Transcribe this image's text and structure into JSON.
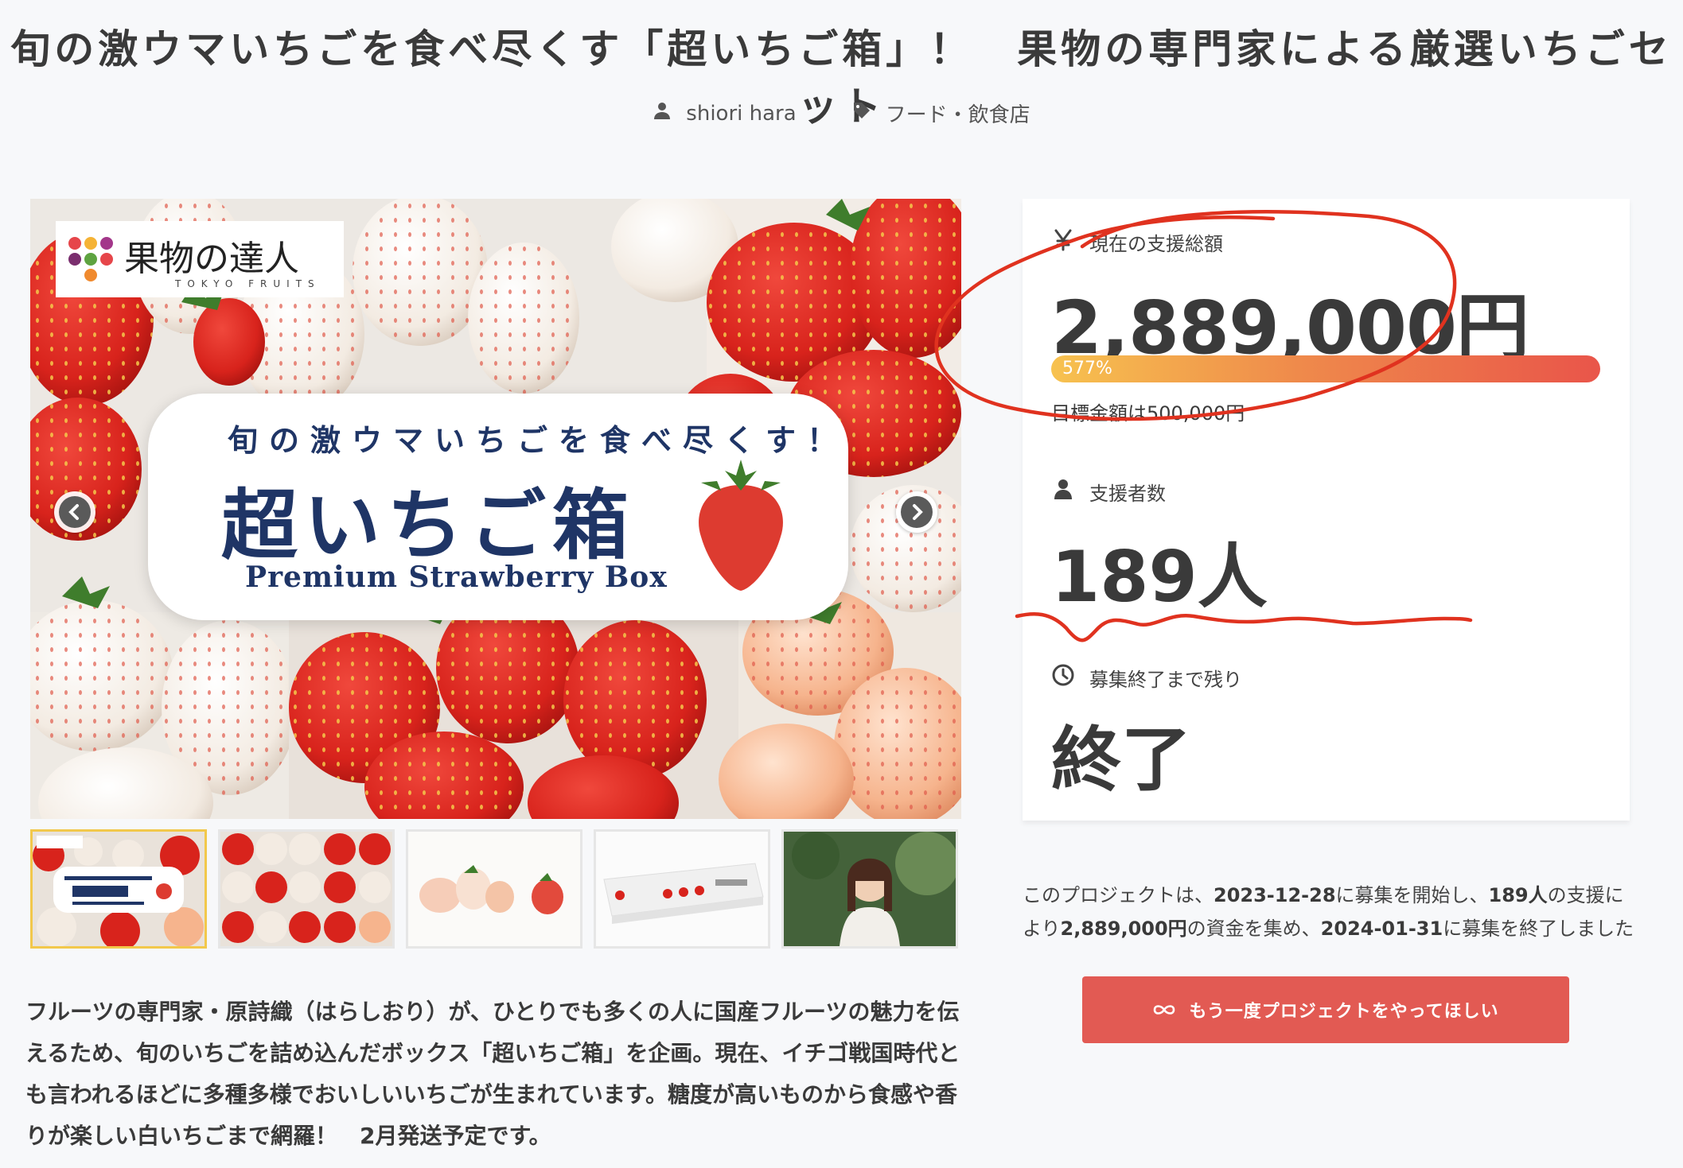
{
  "project": {
    "title": "旬の激ウマいちごを食べ尽くす「超いちご箱」！　果物の専門家による厳選いちごセット",
    "author": "shiori hara",
    "category": "フード・飲食店"
  },
  "hero": {
    "logo_text": "果物の達人",
    "logo_sub": "TOKYO FRUITS",
    "banner_top": "旬の激ウマいちごを食べ尽くす！",
    "banner_main": "超いちご箱",
    "banner_en": "Premium Strawberry Box"
  },
  "thumbnails": [
    {
      "kind": "banner"
    },
    {
      "kind": "strawberry-grid"
    },
    {
      "kind": "white-strawberries"
    },
    {
      "kind": "box-package"
    },
    {
      "kind": "person-portrait"
    }
  ],
  "stats": {
    "total_label": "現在の支援総額",
    "total_amount": "2,889,000円",
    "progress_percent_text": "577%",
    "progress_value": 577,
    "goal_text": "目標金額は500,000円",
    "backers_label": "支援者数",
    "backers_count": "189人",
    "time_label": "募集終了まで残り",
    "time_value": "終了"
  },
  "summary": {
    "p1": "このプロジェクトは、",
    "start_date": "2023-12-28",
    "p2": "に募集を開始し、",
    "backers": "189人",
    "p3": "の支援により",
    "amount": "2,889,000円",
    "p4": "の資金を集め、",
    "end_date": "2024-01-31",
    "p5": "に募集を終了しました"
  },
  "cta": {
    "label": "もう一度プロジェクトをやってほしい"
  },
  "description": "フルーツの専門家・原詩織（はらしおり）が、ひとりでも多くの人に国産フルーツの魅力を伝えるため、旬のいちごを詰め込んだボックス「超いちご箱」を企画。現在、イチゴ戦国時代とも言われるほどに多種多様でおいしいいちごが生まれています。糖度が高いものから食感や香りが楽しい白いちごまで網羅！　2月発送予定です。",
  "colors": {
    "accent_red": "#e25a53",
    "progress_start": "#f7c24f",
    "progress_end": "#e9554a",
    "annotation_red": "#e0321f",
    "banner_navy": "#1f3566",
    "thumb_active": "#f2c84b"
  },
  "icons": {
    "author": "user-icon",
    "category": "tag-icon",
    "total": "yen-icon",
    "backers": "user-icon",
    "time": "clock-icon",
    "cta": "infinity-icon"
  }
}
